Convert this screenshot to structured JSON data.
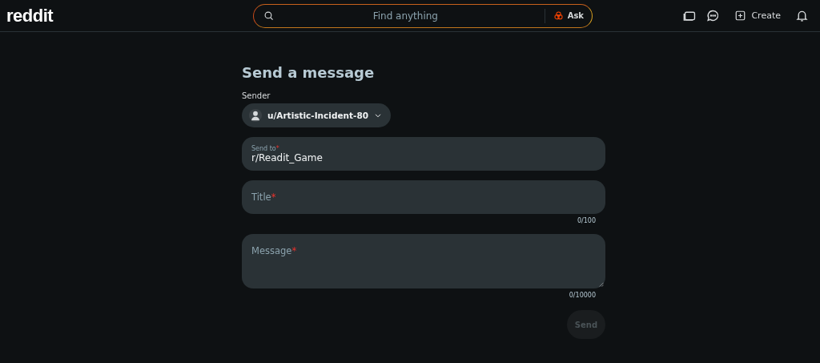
{
  "header": {
    "logo": "reddit",
    "search": {
      "placeholder": "Find anything",
      "ask_label": "Ask"
    },
    "create_label": "Create"
  },
  "form": {
    "title": "Send a message",
    "sender_label": "Sender",
    "sender": "u/Artistic-Incident-80",
    "fields": [
      {
        "kind": "input",
        "label": "Send to",
        "required_mark": "*",
        "value": "r/Readit_Game"
      },
      {
        "kind": "input",
        "label": "Title",
        "required_mark": "*",
        "counter": "0/100"
      },
      {
        "kind": "textarea",
        "label": "Message",
        "required_mark": "*",
        "counter": "0/10000"
      }
    ],
    "send": {
      "label": "Send",
      "disabled": true
    }
  }
}
